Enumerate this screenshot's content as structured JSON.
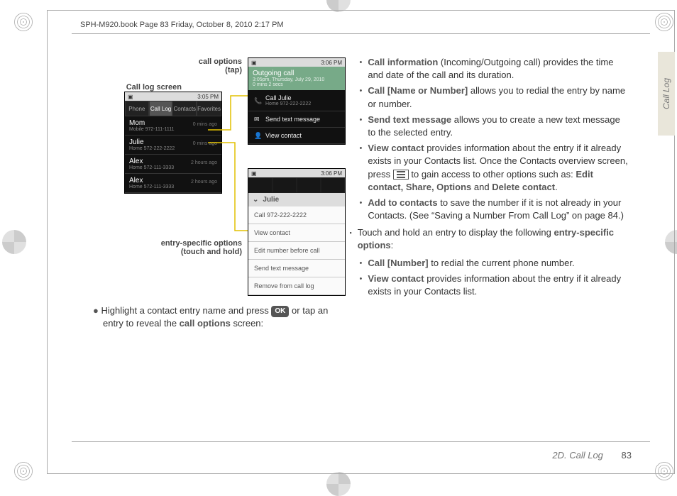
{
  "header": {
    "line": "SPH-M920.book  Page 83  Friday, October 8, 2010  2:17 PM"
  },
  "sideTab": "Call Log",
  "footer": {
    "section": "2D. Call Log",
    "page": "83"
  },
  "callouts": {
    "callOptions1": "call options",
    "callOptions2": "(tap)",
    "callLogScreen": "Call log screen",
    "entryOptions1": "entry-specific options",
    "entryOptions2": "(touch and hold)"
  },
  "screens": {
    "log": {
      "time": "3:05 PM",
      "tabs": [
        "Phone",
        "Call Log",
        "Contacts",
        "Favorites"
      ],
      "rows": [
        {
          "name": "Mom",
          "sub": "Mobile 972-111-1111",
          "ago": "0 mins ago"
        },
        {
          "name": "Julie",
          "sub": "Home 572-222-2222",
          "ago": "0 mins ago"
        },
        {
          "name": "Alex",
          "sub": "Home 572-111-3333",
          "ago": "2 hours ago"
        },
        {
          "name": "Alex",
          "sub": "Home 572-111-3333",
          "ago": "2 hours ago"
        }
      ]
    },
    "optA": {
      "time": "3:06 PM",
      "title": "Outgoing call",
      "sub": "3:05pm, Thursday, July 29, 2010",
      "dur": "0 mins 2 secs",
      "items": [
        {
          "label": "Call Julie",
          "sub": "Home 972-222-2222"
        },
        {
          "label": "Send text message"
        },
        {
          "label": "View contact"
        }
      ]
    },
    "optB": {
      "time": "3:06 PM",
      "title": "Julie",
      "items": [
        "Call 972-222-2222",
        "View contact",
        "Edit number before call",
        "Send text message",
        "Remove from call log"
      ]
    }
  },
  "leftBody": {
    "highlight_pre": "Highlight a contact entry name and press ",
    "ok": "OK",
    "highlight_post": "  or tap an entry to reveal the ",
    "bold": "call options",
    "after": " screen:"
  },
  "right": {
    "b1_bold": "Call information",
    "b1_rest": " (Incoming/Outgoing call) provides the time and date of the call and its duration.",
    "b2_bold": "Call [Name or Number]",
    "b2_rest": " allows you to redial the entry by name or number.",
    "b3_bold": "Send text message",
    "b3_rest": " allows you to create a new text message to the selected entry.",
    "b4_bold": "View contact",
    "b4_rest_a": " provides information about the entry if it already exists in your Contacts list. Once the Contacts overview screen, press ",
    "b4_rest_b": " to gain access to other options such as: ",
    "b4_list": "Edit contact, Share, Options",
    "b4_and": " and ",
    "b4_del": "Delete contact",
    "b4_dot": ".",
    "b5_bold": "Add to contacts",
    "b5_rest": " to save the number if it is not already in your Contacts. (See “Saving a Number From Call Log” on page 84.)",
    "sq_text_a": "Touch and hold an entry to display the following ",
    "sq_bold": "entry-specific options",
    "sq_text_b": ":",
    "b6_bold": "Call [Number]",
    "b6_rest": " to redial the current phone number.",
    "b7_bold": "View contact",
    "b7_rest": " provides information about the entry if it already exists in your Contacts list."
  }
}
